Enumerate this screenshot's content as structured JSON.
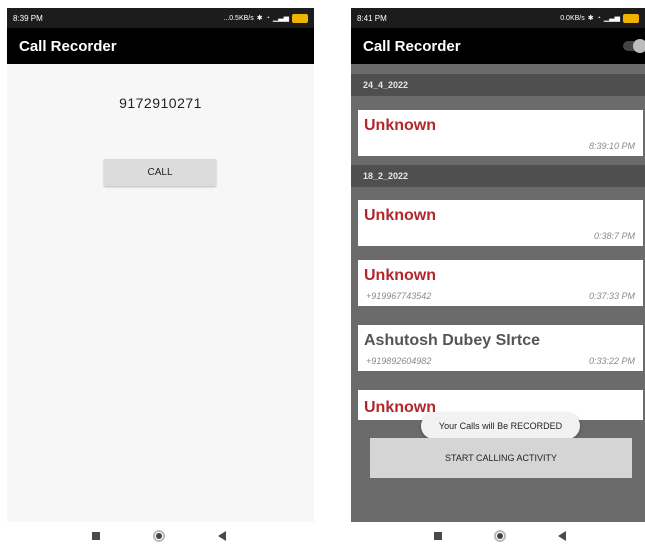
{
  "left_screen": {
    "status": {
      "time": "8:39 PM",
      "speed": "...0.5KB/s"
    },
    "app_title": "Call Recorder",
    "phone_number": "9172910271",
    "call_button": "CALL"
  },
  "right_screen": {
    "status": {
      "time": "8:41 PM",
      "speed": "0.0KB/s"
    },
    "app_title": "Call Recorder",
    "groups": [
      {
        "date": "24_4_2022",
        "calls": [
          {
            "name": "Unknown",
            "number": "",
            "time": "8:39:10 PM"
          }
        ]
      },
      {
        "date": "18_2_2022",
        "calls": [
          {
            "name": "Unknown",
            "number": "",
            "time": "0:38:7 PM"
          },
          {
            "name": "Unknown",
            "number": "+919967743542",
            "time": "0:37:33 PM"
          },
          {
            "name": "Ashutosh Dubey SIrtce",
            "number": "+919892604982",
            "time": "0:33:22 PM"
          },
          {
            "name": "Unknown",
            "number": "",
            "time": ""
          }
        ]
      }
    ],
    "toast": "Your Calls will Be RECORDED",
    "start_button": "START CALLING ACTIVITY"
  },
  "colors": {
    "unknown_name": "#b3262b",
    "contact_name": "#555555",
    "app_bar": "#000000",
    "list_background": "#6b6b6b"
  }
}
